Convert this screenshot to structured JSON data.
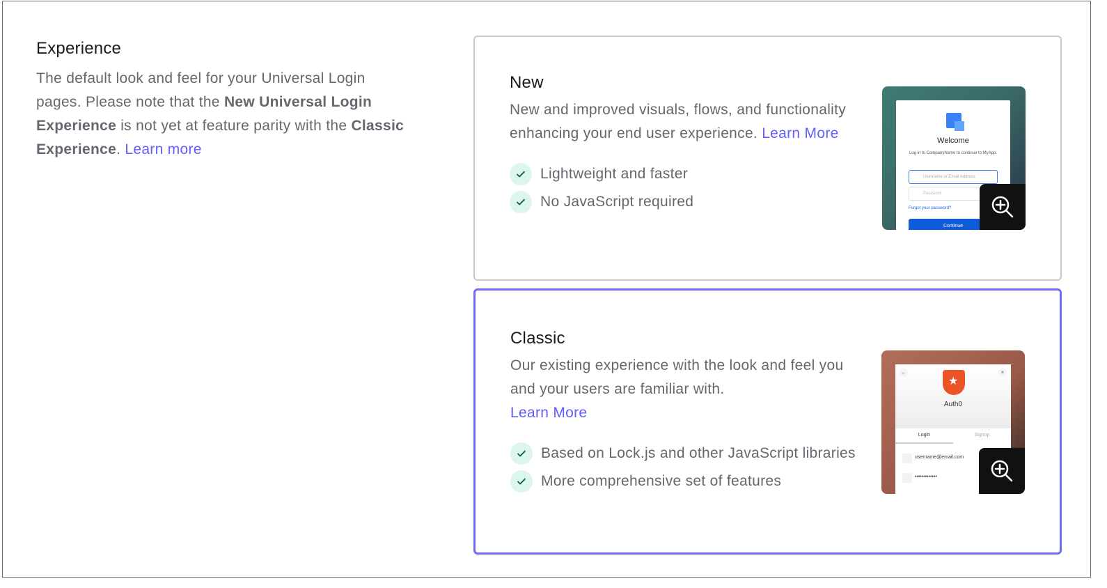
{
  "experience": {
    "title": "Experience",
    "desc_1": "The default look and feel for your Universal Login pages. Please note that the ",
    "bold_1": "New Universal Login Experience",
    "desc_2": " is not yet at feature parity with the ",
    "bold_2": "Classic Experience",
    "desc_3": ". ",
    "learn_more": "Learn more"
  },
  "options": {
    "new": {
      "title": "New",
      "desc": "New and improved visuals, flows, and functionality enhancing your end user experience. ",
      "learn_more": "Learn More",
      "features": [
        "Lightweight and faster",
        "No JavaScript required"
      ],
      "preview": {
        "title": "Welcome",
        "subtitle": "Log in to CompanyName to continue to MyApp.",
        "username_placeholder": "Username or Email Address",
        "password_placeholder": "Password",
        "forgot": "Forgot your password?",
        "button": "Continue"
      }
    },
    "classic": {
      "title": "Classic",
      "desc": "Our existing experience with the look and feel you and your users are familiar with.",
      "learn_more": "Learn More",
      "features": [
        "Based on Lock.js and other JavaScript libraries",
        "More comprehensive set of features"
      ],
      "preview": {
        "brand": "Auth0",
        "tab_login": "Login",
        "tab_signup": "Signup",
        "email": "username@email.com",
        "password": "•••••••••••••"
      }
    }
  },
  "colors": {
    "accent": "#635dff",
    "selected_border": "#6f6af8",
    "check_bg": "#dcf5ee",
    "check_mark": "#0b5c46"
  },
  "icons": {
    "check": "check-icon",
    "zoom": "zoom-in-icon"
  }
}
